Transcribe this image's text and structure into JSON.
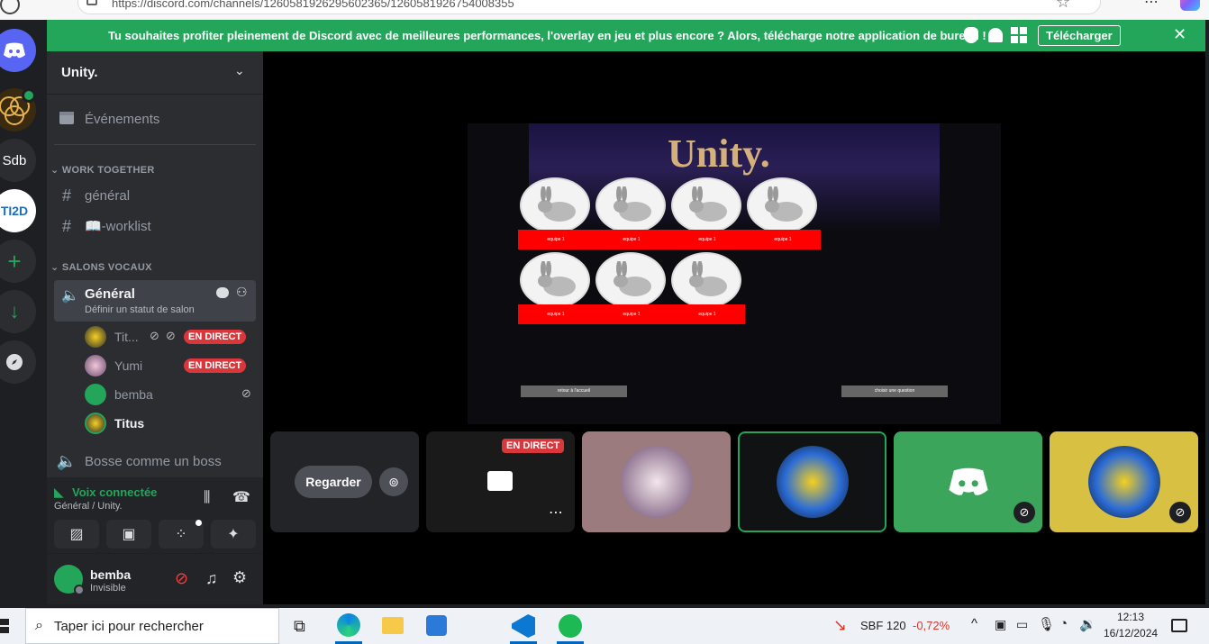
{
  "browser": {
    "url": "https://discord.com/channels/1260581926295602365/1260581926754008355"
  },
  "banner": {
    "text": "Tu souhaites profiter pleinement de Discord avec de meilleures performances, l'overlay en jeu et plus encore ? Alors, télécharge notre application de bureau !",
    "download_label": "Télécharger",
    "close_glyph": "✕"
  },
  "servers": [
    {
      "label": "",
      "icon": "discord-home-icon"
    },
    {
      "label": "",
      "icon": "circles-server-icon"
    },
    {
      "label": "Sdb",
      "icon": "text-server-icon"
    },
    {
      "label": "TI2D",
      "icon": "sti2d-server-icon"
    },
    {
      "label": "+",
      "icon": "add-server-icon"
    },
    {
      "label": "↓",
      "icon": "download-apps-icon"
    },
    {
      "label": "",
      "icon": "explore-icon"
    }
  ],
  "sidebar": {
    "guild_name": "Unity.",
    "events_label": "Événements",
    "category_work": "WORK TOGETHER",
    "channel_general_text": "général",
    "channel_worklist": "📖-worklist",
    "category_voice": "SALONS VOCAUX",
    "voice_channel": "Général",
    "voice_status": "Définir un statut de salon",
    "voice_users": [
      {
        "name": "Tit...",
        "live": "EN DIRECT"
      },
      {
        "name": "Yumi",
        "live": "EN DIRECT"
      },
      {
        "name": "bemba",
        "live": ""
      },
      {
        "name": "Titus",
        "live": ""
      }
    ],
    "voice_channel_2": "Bosse comme un boss"
  },
  "voice_panel": {
    "status": "Voix connectée",
    "location": "Général / Unity."
  },
  "user_panel": {
    "username": "bemba",
    "status": "Invisible"
  },
  "stage": {
    "stream_title": "Unity.",
    "card_label": "equipe 1",
    "btn_home": "retour à l'accueil",
    "btn_question": "choisir une question",
    "watch_label": "Regarder",
    "live_badge": "EN DIRECT"
  },
  "taskbar": {
    "search_placeholder": "Taper ici pour rechercher",
    "stock_name": "SBF 120",
    "stock_change": "-0,72%",
    "time": "12:13",
    "date": "16/12/2024"
  },
  "colors": {
    "green": "#23a55a",
    "red": "#da373c",
    "sidebar": "#2b2d31",
    "rail": "#1e1f22"
  }
}
